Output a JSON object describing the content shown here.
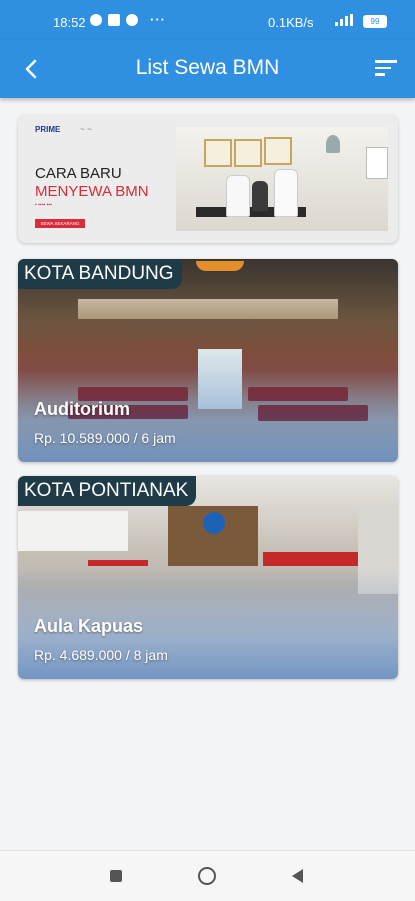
{
  "status_bar": {
    "time": "18:52",
    "dots": "···",
    "net_speed": "0.1KB/s",
    "battery": "99"
  },
  "app_bar": {
    "title": "List Sewa BMN",
    "back_icon": "chevron-left-icon",
    "filter_icon": "filter-icon",
    "color": "#2f8fe0"
  },
  "banner": {
    "brand": "PRIME",
    "line1": "CARA BARU",
    "line2": "MENYEWA BMN",
    "cta": "SEWA SEKARANG"
  },
  "listings": [
    {
      "city": "KOTA BANDUNG",
      "name": "Auditorium",
      "price": "Rp. 10.589.000 / 6 jam"
    },
    {
      "city": "KOTA PONTIANAK",
      "name": "Aula Kapuas",
      "price": "Rp. 4.689.000 / 8 jam"
    }
  ],
  "nav_bar": {
    "recents_icon": "square-icon",
    "home_icon": "circle-icon",
    "back_icon": "triangle-back-icon"
  }
}
